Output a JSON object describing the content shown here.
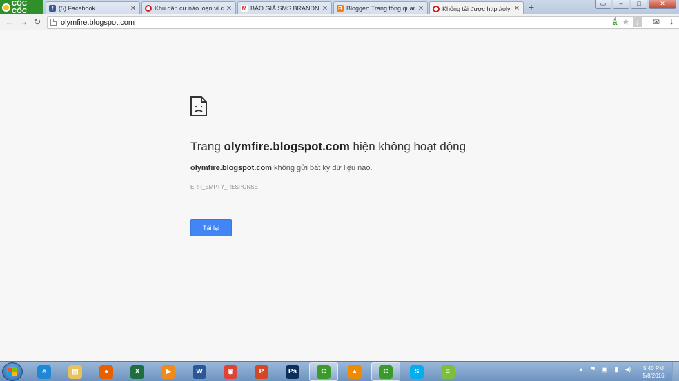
{
  "browser": {
    "brand_name": "CỐC CỐC",
    "tabs": [
      {
        "title": "(5) Facebook",
        "icon": "facebook-icon",
        "color": "#3b5998"
      },
      {
        "title": "Khu dân cư nào loạn vì chư",
        "icon": "opera-icon",
        "color": "#cc1f1f"
      },
      {
        "title": "BÁO GIÁ SMS BRANDNAM",
        "icon": "gmail-icon",
        "color": "#d93025"
      },
      {
        "title": "Blogger: Trang tổng quan",
        "icon": "blogger-icon",
        "color": "#f57d00"
      },
      {
        "title": "Không tải được http://olym",
        "icon": "opera-icon",
        "color": "#cc1f1f"
      }
    ],
    "new_tab_symbol": "+",
    "window_controls": [
      "▭",
      "–",
      "□",
      "✕"
    ],
    "url": "olymfire.blogspot.com"
  },
  "error_page": {
    "heading_prefix": "Trang ",
    "heading_domain": "olymfire.blogspot.com",
    "heading_suffix": " hiện không hoạt động",
    "desc_domain": "olymfire.blogspot.com",
    "desc_text": " không gửi bất kỳ dữ liệu nào.",
    "error_code": "ERR_EMPTY_RESPONSE",
    "reload_label": "Tải lại"
  },
  "taskbar": {
    "apps": [
      {
        "name": "internet-explorer-icon",
        "glyph": "e",
        "color": "#1e88d6",
        "open": false
      },
      {
        "name": "file-explorer-icon",
        "glyph": "▤",
        "color": "#e8c25a",
        "open": false
      },
      {
        "name": "firefox-icon",
        "glyph": "●",
        "color": "#e66000",
        "open": false
      },
      {
        "name": "excel-icon",
        "glyph": "X",
        "color": "#1d6f42",
        "open": false
      },
      {
        "name": "media-player-icon",
        "glyph": "▶",
        "color": "#f08a1c",
        "open": false
      },
      {
        "name": "word-icon",
        "glyph": "W",
        "color": "#2b579a",
        "open": false
      },
      {
        "name": "chrome-icon",
        "glyph": "◉",
        "color": "#db4437",
        "open": false
      },
      {
        "name": "powerpoint-icon",
        "glyph": "P",
        "color": "#d24726",
        "open": false
      },
      {
        "name": "photoshop-icon",
        "glyph": "Ps",
        "color": "#0b2f5a",
        "open": false
      },
      {
        "name": "coccoc-icon",
        "glyph": "C",
        "color": "#3a9a2a",
        "open": true
      },
      {
        "name": "vlc-icon",
        "glyph": "▲",
        "color": "#f08a00",
        "open": false
      },
      {
        "name": "coccoc-icon-2",
        "glyph": "C",
        "color": "#3a9a2a",
        "open": true
      },
      {
        "name": "skype-icon",
        "glyph": "S",
        "color": "#00aff0",
        "open": false
      },
      {
        "name": "bluestacks-icon",
        "glyph": "≡",
        "color": "#7bbf3a",
        "open": false
      }
    ],
    "tray_icons": [
      "▴",
      "⚑",
      "▣",
      "▮",
      "◂)"
    ],
    "time": "5:40 PM",
    "date": "5/8/2016"
  }
}
